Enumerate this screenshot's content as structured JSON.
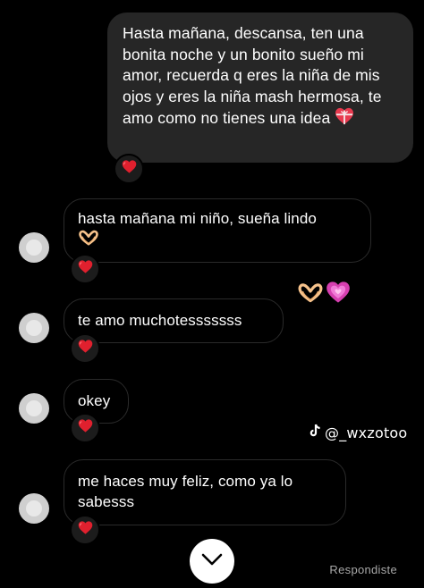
{
  "messages": {
    "sent_1": {
      "text": "Hasta mañana, descansa, ten una bonita noche y un bonito sueño mi amor, recuerda q eres la niña de mis ojos y eres la niña mash hermosa, te amo como no tienes una idea",
      "emoji": "heart-with-ribbon",
      "reaction": "red-heart"
    },
    "recv_1": {
      "text": "hasta mañana mi niño, sueña lindo",
      "emoji": "heart-hands",
      "reaction": "red-heart"
    },
    "sent_2": {
      "emojis": [
        "heart-hands",
        "growing-pink-heart"
      ]
    },
    "recv_2": {
      "text": "te amo muchotesssssss",
      "reaction": "red-heart"
    },
    "recv_3": {
      "text": "okey",
      "reaction": "red-heart"
    },
    "recv_4": {
      "text": "me haces muy feliz, como ya lo sabesss",
      "reaction": "red-heart"
    }
  },
  "watermark": {
    "handle": "@_wxzotoo",
    "icon": "tiktok-icon"
  },
  "status": {
    "seen_label": "Respondiste"
  },
  "controls": {
    "scroll_down_icon": "chevron-down-icon"
  },
  "colors": {
    "background": "#000000",
    "sent_bubble": "#262626",
    "received_border": "#2a2a2a",
    "reaction_heart": "#e0202e",
    "status_text": "#a8a8a8"
  }
}
